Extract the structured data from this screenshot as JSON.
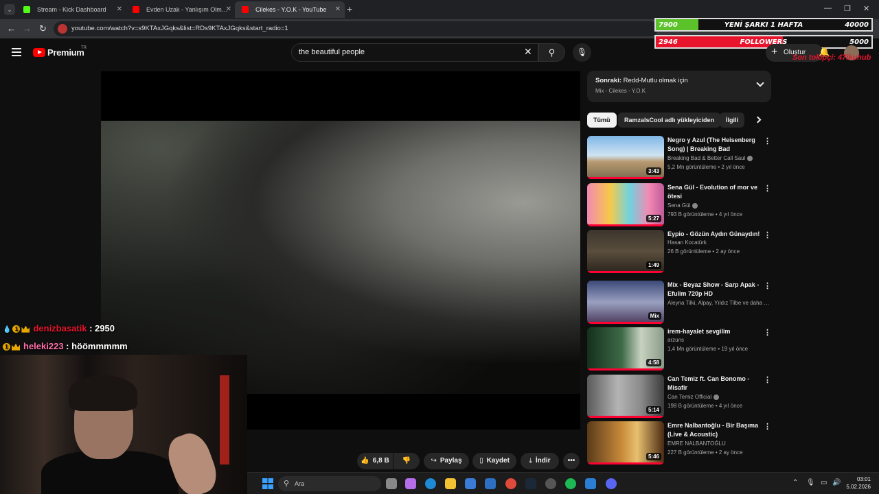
{
  "browser": {
    "tabs": [
      {
        "title": "Stream - Kick Dashboard",
        "fav_color": "#53fc18"
      },
      {
        "title": "Evden Uzak - Yanlışım Olma - Y",
        "fav_color": "#ff0000"
      },
      {
        "title": "Cilekes - Y.O.K - YouTube",
        "fav_color": "#ff0000"
      }
    ],
    "url": "youtube.com/watch?v=s9KTAxJGqks&list=RDs9KTAxJGqks&start_radio=1"
  },
  "overlay": {
    "song_goal": {
      "current": "7900",
      "label": "YENİ ŞARKI 1 HAFTA",
      "target": "40000",
      "progress": 0.1975,
      "color": "#5cc22a"
    },
    "followers": {
      "current": "2946",
      "label": "FOLLOWERS",
      "target": "5000",
      "progress": 0.589,
      "color": "#e8142c"
    },
    "tip_text": "Son tokipçi: 47ikuhub"
  },
  "youtube": {
    "brand": "Premium",
    "region": "TR",
    "search_value": "the beautiful people",
    "create_label": "Oluştur"
  },
  "chat": [
    {
      "user": "denizbasatik",
      "message": ": 2950"
    },
    {
      "user": "heleki223",
      "message": ": höömmmmm"
    }
  ],
  "actions": {
    "likes": "6,8 B",
    "share": "Paylaş",
    "save": "Kaydet",
    "download": "İndir"
  },
  "up_next": {
    "prefix": "Sonraki:",
    "title": "Redd-Mutlu olmak için",
    "subtitle": "Mix - Cilekes - Y.O.K"
  },
  "chips": [
    "Tümü",
    "RamzalsCool adlı yükleyiciden",
    "İlgili"
  ],
  "videos": [
    {
      "title": "Negro y Azul (The Heisenberg Song) | Breaking Bad",
      "channel": "Breaking Bad & Better Call Saul",
      "verified": true,
      "views": "5,2 Mn görüntüleme",
      "age": "2 yıl önce",
      "duration": "3:43",
      "thumb": "linear-gradient(180deg,#7fb6e6 0%,#cfe3f2 45%,#b89a70 60%,#7a6a50 100%)"
    },
    {
      "title": "Sena Gül - Evolution of mor ve ötesi",
      "channel": "Sena Gül",
      "verified": true,
      "views": "793 B görüntüleme",
      "age": "4 yıl önce",
      "duration": "5:27",
      "thumb": "linear-gradient(90deg,#f28ab2 0%,#f7c948 30%,#6fd3e0 55%,#f28ab2 80%,#c05a9a 100%)"
    },
    {
      "title": "Eypio - Gözün Aydın Günaydın!",
      "channel": "Hasan Kocatürk",
      "verified": false,
      "views": "26 B görüntüleme",
      "age": "2 ay önce",
      "duration": "1:49",
      "thumb": "linear-gradient(180deg,#3b352c 0%,#5a4e3c 50%,#2a241d 100%)"
    },
    {
      "title": "Mix - Beyaz Show - Sarp Apak - Efulim 720p HD",
      "channel": "Aleyna Tilki, Alpay, Yıldız Tilbe ve daha fazlası",
      "verified": false,
      "views": "",
      "age": "",
      "duration": "Mix",
      "thumb": "linear-gradient(180deg,#3c4a7a 0%,#9aa0c0 50%,#4a3a5a 100%)"
    },
    {
      "title": "irem-hayalet sevgilim",
      "channel": "arzuns",
      "verified": false,
      "views": "1,4 Mn görüntüleme",
      "age": "19 yıl önce",
      "duration": "4:58",
      "thumb": "linear-gradient(90deg,#15301c 0%,#3d6a48 45%,#c8d2c0 70%,#8a9a88 100%)"
    },
    {
      "title": "Can Temiz ft. Can Bonomo - Misafir",
      "channel": "Can Temiz Official",
      "verified": true,
      "views": "198 B görüntüleme",
      "age": "4 yıl önce",
      "duration": "5:14",
      "thumb": "linear-gradient(90deg,#5a5a5a 0%,#b4b4b4 40%,#8a8a8a 70%,#3a3a3a 100%)"
    },
    {
      "title": "Emre Nalbantoğlu - Bir Başıma (Live & Acoustic)",
      "channel": "EMRE NALBANTOĞLU",
      "verified": false,
      "views": "227 B görüntüleme",
      "age": "2 ay önce",
      "duration": "5:46",
      "thumb": "linear-gradient(90deg,#5a3a1a 0%,#c88a3a 45%,#e8c070 65%,#4a2a12 100%)"
    }
  ],
  "taskbar": {
    "search_label": "Ara",
    "time": "03:01",
    "date": "5.02.2026"
  }
}
